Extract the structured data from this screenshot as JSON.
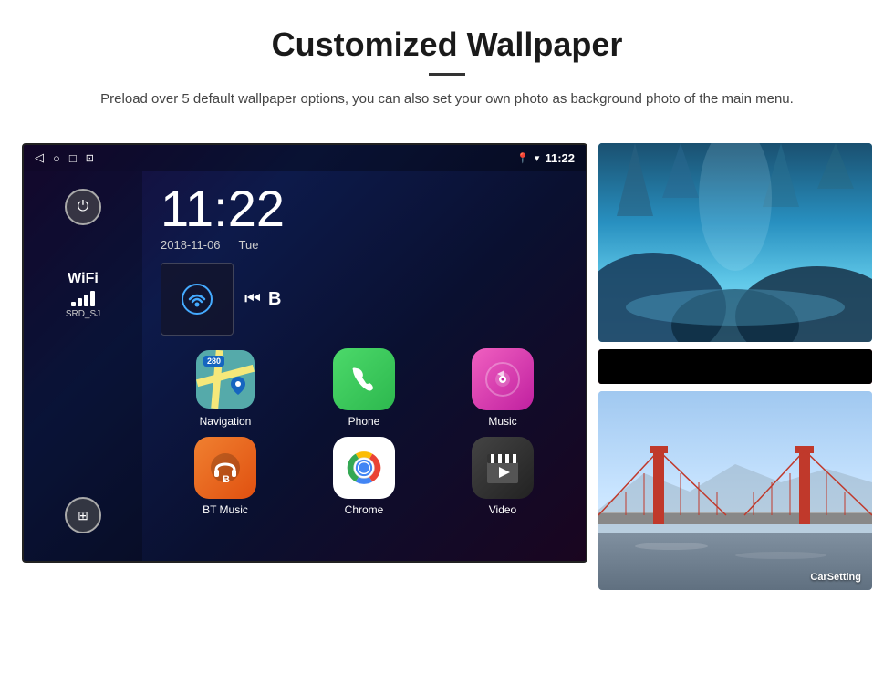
{
  "header": {
    "title": "Customized Wallpaper",
    "description": "Preload over 5 default wallpaper options, you can also set your own photo as background photo of the main menu."
  },
  "statusBar": {
    "time": "11:22",
    "back_icon": "◁",
    "home_icon": "○",
    "recents_icon": "□",
    "screenshot_icon": "⊡",
    "location_icon": "📍",
    "wifi_icon": "▾",
    "time_label": "11:22"
  },
  "sidebar": {
    "power_icon": "⏻",
    "wifi_label": "WiFi",
    "wifi_ssid": "SRD_SJ",
    "apps_icon": "⊞"
  },
  "clock": {
    "time": "11:22",
    "date": "2018-11-06",
    "day": "Tue"
  },
  "apps": [
    {
      "id": "navigation",
      "label": "Navigation",
      "badge": "280"
    },
    {
      "id": "phone",
      "label": "Phone"
    },
    {
      "id": "music",
      "label": "Music"
    },
    {
      "id": "btmusic",
      "label": "BT Music"
    },
    {
      "id": "chrome",
      "label": "Chrome"
    },
    {
      "id": "video",
      "label": "Video"
    }
  ],
  "wallpapers": [
    {
      "id": "ice",
      "label": "Ice Cave"
    },
    {
      "id": "bridge",
      "label": "CarSetting"
    }
  ]
}
